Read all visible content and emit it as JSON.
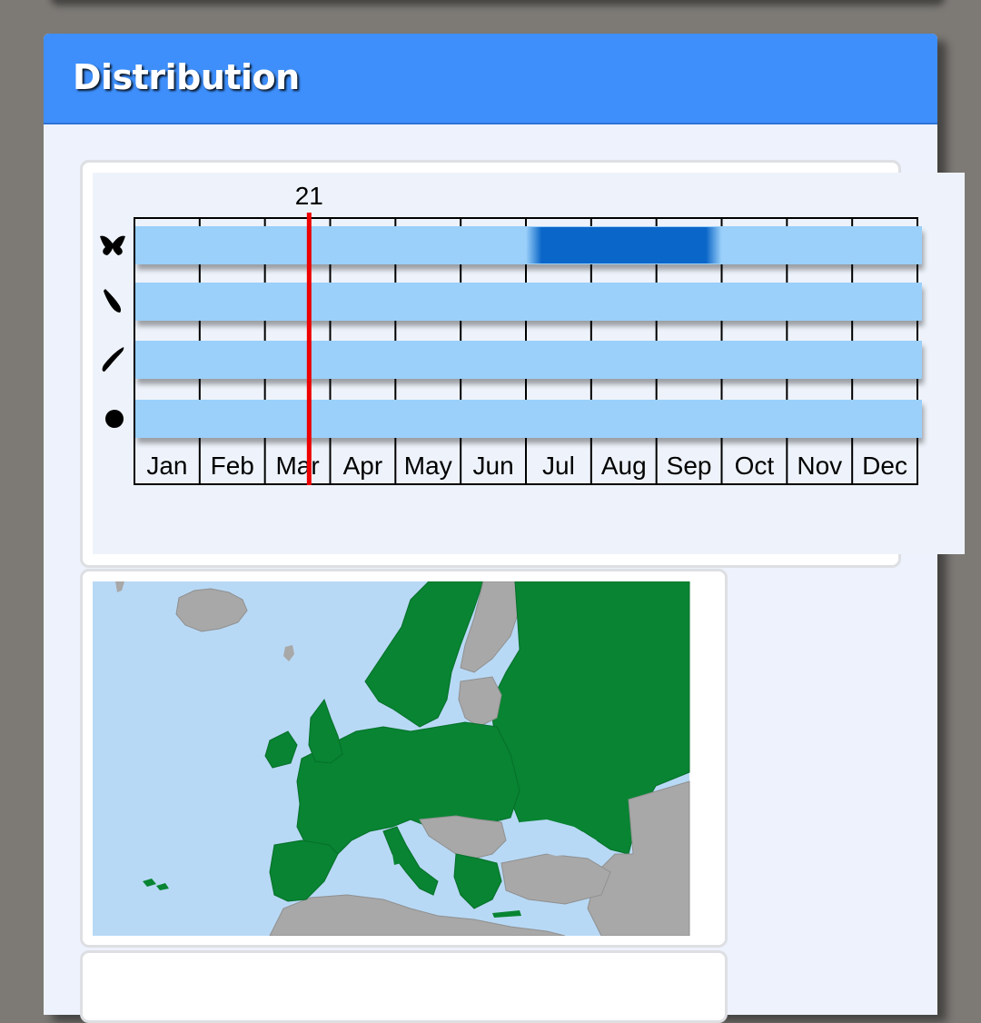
{
  "section": {
    "title": "Distribution"
  },
  "flight_chart": {
    "current_day_label": "21",
    "months": [
      "Jan",
      "Feb",
      "Mar",
      "Apr",
      "May",
      "Jun",
      "Jul",
      "Aug",
      "Sep",
      "Oct",
      "Nov",
      "Dec"
    ],
    "rows": [
      {
        "icon": "butterfly-icon",
        "highlight_months": [
          "Jul",
          "Aug",
          "Sep"
        ]
      },
      {
        "icon": "caterpillar-icon",
        "highlight_months": []
      },
      {
        "icon": "pupa-icon",
        "highlight_months": []
      },
      {
        "icon": "egg-icon",
        "highlight_months": []
      }
    ],
    "colors": {
      "band": "#9ad0fa",
      "highlight": "#0a66c8",
      "marker": "#ee0000",
      "background": "#eef3fb"
    }
  },
  "map": {
    "colors": {
      "sea": "#b8d9f5",
      "present": "#088432",
      "absent": "#a8a8a8"
    }
  }
}
